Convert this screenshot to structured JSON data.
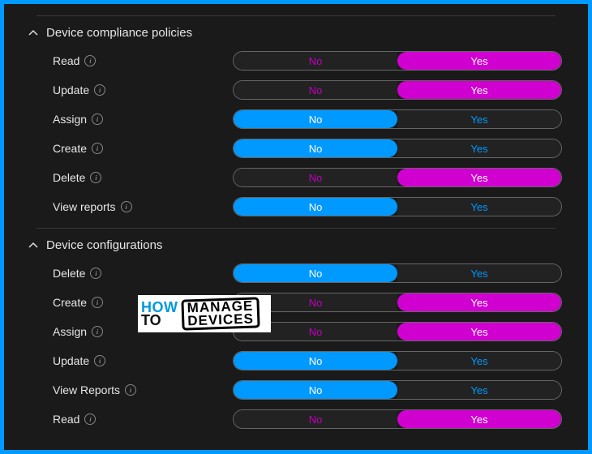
{
  "labels": {
    "no": "No",
    "yes": "Yes"
  },
  "sections": [
    {
      "title": "Device compliance policies",
      "permissions": [
        {
          "name": "Read",
          "selected": "yes",
          "active_color": "magenta"
        },
        {
          "name": "Update",
          "selected": "yes",
          "active_color": "magenta"
        },
        {
          "name": "Assign",
          "selected": "no",
          "active_color": "blue"
        },
        {
          "name": "Create",
          "selected": "no",
          "active_color": "blue"
        },
        {
          "name": "Delete",
          "selected": "yes",
          "active_color": "magenta"
        },
        {
          "name": "View reports",
          "selected": "no",
          "active_color": "blue"
        }
      ]
    },
    {
      "title": "Device configurations",
      "permissions": [
        {
          "name": "Delete",
          "selected": "no",
          "active_color": "blue"
        },
        {
          "name": "Create",
          "selected": "yes",
          "active_color": "magenta"
        },
        {
          "name": "Assign",
          "selected": "yes",
          "active_color": "magenta"
        },
        {
          "name": "Update",
          "selected": "no",
          "active_color": "blue"
        },
        {
          "name": "View Reports",
          "selected": "no",
          "active_color": "blue"
        },
        {
          "name": "Read",
          "selected": "yes",
          "active_color": "magenta"
        }
      ]
    }
  ],
  "watermark": {
    "line1": "HOW",
    "line2": "TO",
    "line3": "MANAGE",
    "line4": "DEVICES"
  }
}
